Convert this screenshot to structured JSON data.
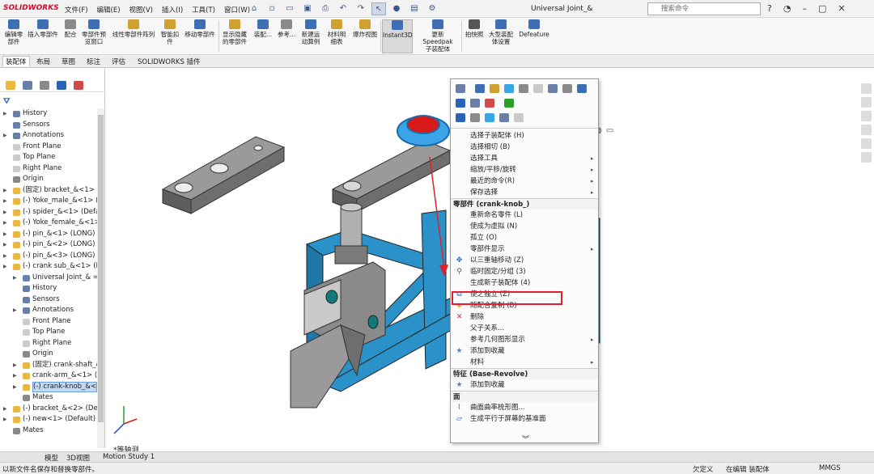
{
  "app": {
    "logo": "SOLIDWORKS",
    "window_title": "Universal Joint_&"
  },
  "menu": [
    "文件(F)",
    "编辑(E)",
    "视图(V)",
    "插入(I)",
    "工具(T)",
    "窗口(W)"
  ],
  "search": {
    "placeholder": "搜索命令"
  },
  "ribbon": [
    {
      "label": "编辑零\n部件",
      "color": "#3e6fb5"
    },
    {
      "label": "插入零部件",
      "color": "#3e6fb5"
    },
    {
      "label": "配合",
      "color": "#8a8a8a"
    },
    {
      "label": "零部件预\n览窗口",
      "color": "#3e6fb5"
    },
    {
      "label": "线性零部件阵列",
      "color": "#d0a030"
    },
    {
      "label": "智能扣\n件",
      "color": "#d0a030"
    },
    {
      "label": "移动零部件",
      "color": "#3e6fb5"
    },
    {
      "label": "显示隐藏\n的零部件",
      "color": "#d0a030"
    },
    {
      "label": "装配...",
      "color": "#3e6fb5"
    },
    {
      "label": "参考...",
      "color": "#8a8a8a"
    },
    {
      "label": "新建运\n动算例",
      "color": "#3e6fb5"
    },
    {
      "label": "材料明\n细表",
      "color": "#d0a030"
    },
    {
      "label": "爆炸视图",
      "color": "#d0a030"
    },
    {
      "label": "Instant3D",
      "color": "#3e6fb5"
    },
    {
      "label": "更新 Speedpak\n子装配体",
      "color": "#3e6fb5"
    },
    {
      "label": "拍快照",
      "color": "#555555"
    },
    {
      "label": "大型装配\n体设置",
      "color": "#3e6fb5"
    },
    {
      "label": "Defeature",
      "color": "#3e6fb5"
    }
  ],
  "tabs": [
    "装配体",
    "布局",
    "草图",
    "标注",
    "评估",
    "SOLIDWORKS 插件"
  ],
  "tree": [
    {
      "label": "History",
      "indent": 0,
      "arrow": true,
      "icon": "#6a7fa8"
    },
    {
      "label": "Sensors",
      "indent": 0,
      "arrow": false,
      "icon": "#6a7fa8"
    },
    {
      "label": "Annotations",
      "indent": 0,
      "arrow": true,
      "icon": "#6a7fa8"
    },
    {
      "label": "Front Plane",
      "indent": 0,
      "arrow": false,
      "icon": "#cccccc"
    },
    {
      "label": "Top Plane",
      "indent": 0,
      "arrow": false,
      "icon": "#cccccc"
    },
    {
      "label": "Right Plane",
      "indent": 0,
      "arrow": false,
      "icon": "#cccccc"
    },
    {
      "label": "Origin",
      "indent": 0,
      "arrow": false,
      "icon": "#888888"
    },
    {
      "label": "(固定) bracket_&<1> (",
      "indent": 0,
      "arrow": true,
      "icon": "#e8b840"
    },
    {
      "label": "(-) Yoke_male_&<1> (",
      "indent": 0,
      "arrow": true,
      "icon": "#e8b840"
    },
    {
      "label": "(-) spider_&<1> (Defa",
      "indent": 0,
      "arrow": true,
      "icon": "#e8b840"
    },
    {
      "label": "(-) Yoke_female_&<1>",
      "indent": 0,
      "arrow": true,
      "icon": "#e8b840"
    },
    {
      "label": "(-) pin_&<1> (LONG)",
      "indent": 0,
      "arrow": true,
      "icon": "#e8b840"
    },
    {
      "label": "(-) pin_&<2> (LONG)",
      "indent": 0,
      "arrow": true,
      "icon": "#e8b840"
    },
    {
      "label": "(-) pin_&<3> (LONG)",
      "indent": 0,
      "arrow": true,
      "icon": "#e8b840"
    },
    {
      "label": "(-) crank sub_&<1> (D",
      "indent": 0,
      "arrow": true,
      "icon": "#e8b840"
    },
    {
      "label": "Universal Joint_& =",
      "indent": 1,
      "arrow": true,
      "icon": "#6a7fa8"
    },
    {
      "label": "History",
      "indent": 1,
      "arrow": false,
      "icon": "#6a7fa8"
    },
    {
      "label": "Sensors",
      "indent": 1,
      "arrow": false,
      "icon": "#6a7fa8"
    },
    {
      "label": "Annotations",
      "indent": 1,
      "arrow": true,
      "icon": "#6a7fa8"
    },
    {
      "label": "Front Plane",
      "indent": 1,
      "arrow": false,
      "icon": "#cccccc"
    },
    {
      "label": "Top Plane",
      "indent": 1,
      "arrow": false,
      "icon": "#cccccc"
    },
    {
      "label": "Right Plane",
      "indent": 1,
      "arrow": false,
      "icon": "#cccccc"
    },
    {
      "label": "Origin",
      "indent": 1,
      "arrow": false,
      "icon": "#888888"
    },
    {
      "label": "(固定) crank-shaft_&",
      "indent": 1,
      "arrow": true,
      "icon": "#e8b840"
    },
    {
      "label": "crank-arm_&<1> (",
      "indent": 1,
      "arrow": true,
      "icon": "#e8b840"
    },
    {
      "label": "(-) crank-knob_&<",
      "indent": 1,
      "arrow": true,
      "icon": "#e8b840",
      "selected": true
    },
    {
      "label": "Mates",
      "indent": 1,
      "arrow": false,
      "icon": "#8a8a8a"
    },
    {
      "label": "(-) bracket_&<2> (Def",
      "indent": 0,
      "arrow": true,
      "icon": "#e8b840"
    },
    {
      "label": "(-) new<1> (Default) <",
      "indent": 0,
      "arrow": true,
      "icon": "#e8b840"
    },
    {
      "label": "Mates",
      "indent": 0,
      "arrow": false,
      "icon": "#8a8a8a"
    }
  ],
  "context_menu": {
    "items": [
      {
        "type": "item",
        "label": "选择子装配体 (H)"
      },
      {
        "type": "item",
        "label": "选择相切 (B)"
      },
      {
        "type": "item",
        "label": "选择工具",
        "sub": true
      },
      {
        "type": "item",
        "label": "缩放/平移/旋转",
        "sub": true
      },
      {
        "type": "item",
        "label": "最近的命令(R)",
        "sub": true
      },
      {
        "type": "item",
        "label": "保存选择",
        "sub": true
      },
      {
        "type": "head",
        "label": "零部件 (crank-knob_)"
      },
      {
        "type": "item",
        "label": "重新命名零件 (L)"
      },
      {
        "type": "item",
        "label": "使成为虚拟 (N)"
      },
      {
        "type": "item",
        "label": "孤立 (O)"
      },
      {
        "type": "item",
        "label": "零部件显示",
        "sub": true
      },
      {
        "type": "item",
        "label": "以三重轴移动 (Z)",
        "icon": "✥",
        "icolor": "#2a62b5"
      },
      {
        "type": "item",
        "label": "临时固定/分组 (3)",
        "icon": "⚲",
        "icolor": "#2a62b5"
      },
      {
        "type": "item",
        "label": "生成新子装配体 (4)"
      },
      {
        "type": "item",
        "label": "使之独立 (Z)",
        "icon": "⧉",
        "icolor": "#2a62b5"
      },
      {
        "type": "item",
        "label": "随配合复制 (B)",
        "icon": "◈",
        "icolor": "#d0a030"
      },
      {
        "type": "item",
        "label": "删除",
        "icon": "✕",
        "icolor": "#e0202a"
      },
      {
        "type": "item",
        "label": "父子关系..."
      },
      {
        "type": "item",
        "label": "参考几何图形显示",
        "sub": true
      },
      {
        "type": "item",
        "label": "添加到收藏",
        "icon": "★",
        "icolor": "#6a7fa8"
      },
      {
        "type": "item",
        "label": "材料",
        "sub": true
      },
      {
        "type": "head",
        "label": "特征 (Base-Revolve)"
      },
      {
        "type": "item",
        "label": "添加到收藏",
        "icon": "★",
        "icolor": "#6a7fa8"
      },
      {
        "type": "head",
        "label": "面"
      },
      {
        "type": "item",
        "label": "曲面曲率梳形图...",
        "icon": "⌇",
        "icolor": "#2a62b5"
      },
      {
        "type": "item",
        "label": "生成平行于屏幕的基准面",
        "icon": "▱",
        "icolor": "#2a62b5"
      }
    ],
    "more": "︾"
  },
  "view_label": "*等轴测",
  "bottom_tabs": [
    "模型",
    "3D视图",
    "Motion Study 1"
  ],
  "status": {
    "left": "以新文件名保存和替换零部件。",
    "state": "欠定义",
    "mode": "在编辑 装配体",
    "units": "MMGS"
  },
  "colors": {
    "accent": "#2a62b5",
    "highlight": "#e0202a",
    "part_blue": "#2a92c8",
    "part_gray": "#8a8a8a"
  }
}
